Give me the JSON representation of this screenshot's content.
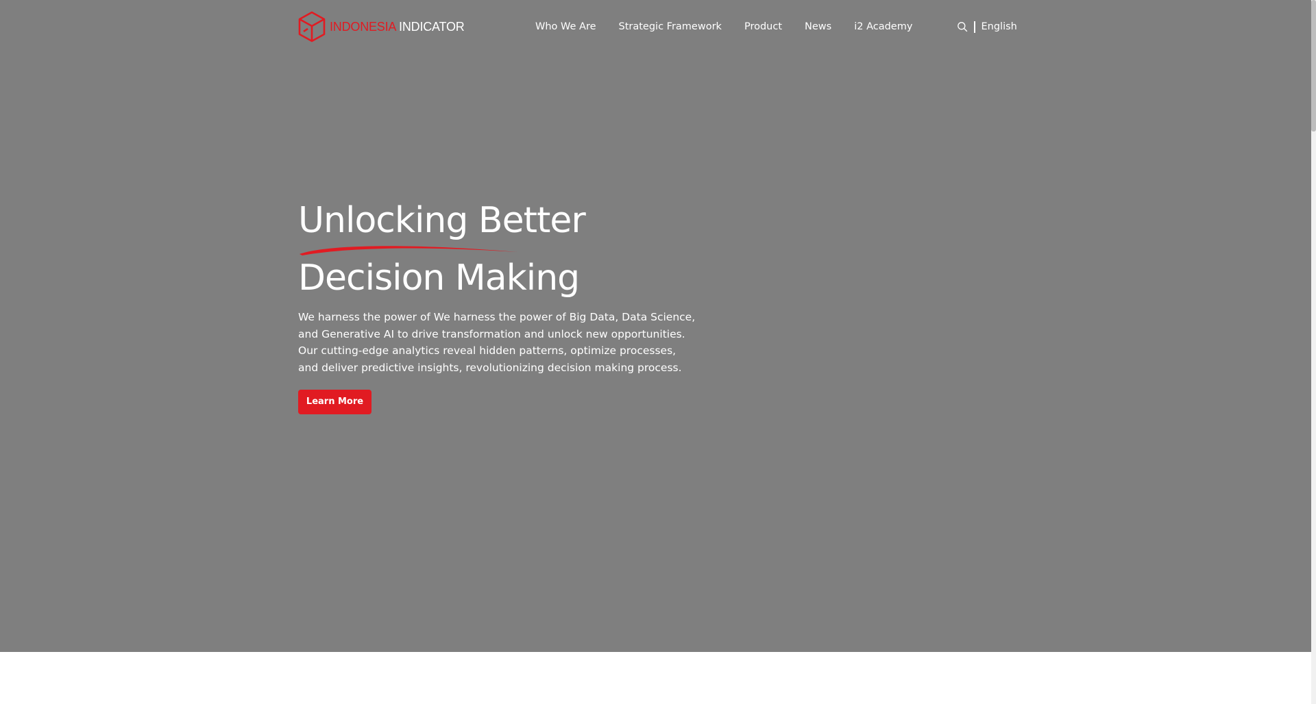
{
  "brand": {
    "logo_icon": "cube-logo-icon",
    "name_part1": "INDONESIA",
    "name_part2": "INDICATOR",
    "accent_color": "#e11b22"
  },
  "nav": {
    "items": [
      {
        "label": "Who We Are"
      },
      {
        "label": "Strategic Framework"
      },
      {
        "label": "Product"
      },
      {
        "label": "News"
      },
      {
        "label": "i2 Academy"
      }
    ]
  },
  "utility": {
    "search_icon": "search-icon",
    "language": "English"
  },
  "hero": {
    "background_color": "#7f7f7f",
    "headline_line1": "Unlocking Better",
    "headline_line2": "Decision Making",
    "description": "We harness the power of We harness the power of Big Data, Data Science, and Generative AI to drive transformation and unlock new opportunities. Our cutting-edge analytics reveal hidden patterns, optimize processes, and deliver predictive insights, revolutionizing decision making process.",
    "cta_label": "Learn More"
  }
}
